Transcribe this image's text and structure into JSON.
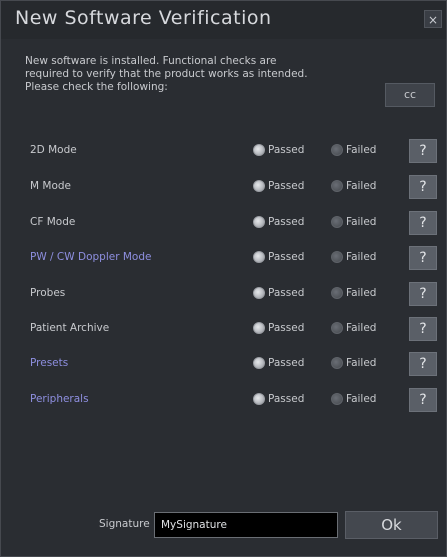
{
  "dialog": {
    "title": "New Software Verification",
    "close_glyph": "×",
    "instructions": "New software is installed. Functional checks are\nrequired to verify that the product works as intended.\nPlease check the following:",
    "cc_label": "cc"
  },
  "options": {
    "passed": "Passed",
    "failed": "Failed",
    "help": "?"
  },
  "checks": [
    {
      "label": "2D Mode",
      "selected": "passed",
      "label_color": "#c8cace"
    },
    {
      "label": "M Mode",
      "selected": "passed",
      "label_color": "#c8cace"
    },
    {
      "label": "CF Mode",
      "selected": "passed",
      "label_color": "#c8cace"
    },
    {
      "label": "PW / CW Doppler Mode",
      "selected": "passed",
      "label_color": "#8e8fe0"
    },
    {
      "label": "Probes",
      "selected": "passed",
      "label_color": "#c8cace"
    },
    {
      "label": "Patient Archive",
      "selected": "passed",
      "label_color": "#c8cace"
    },
    {
      "label": "Presets",
      "selected": "passed",
      "label_color": "#8e8fe0"
    },
    {
      "label": "Peripherals",
      "selected": "passed",
      "label_color": "#8e8fe0"
    }
  ],
  "footer": {
    "signature_label": "Signature",
    "signature_value": "MySignature",
    "ok_label": "Ok"
  },
  "colors": {
    "background": "#2a2d32",
    "titlebar": "#26292d",
    "text": "#c8cace",
    "accent_label": "#8e8fe0",
    "help_button": "#5a5f67"
  }
}
